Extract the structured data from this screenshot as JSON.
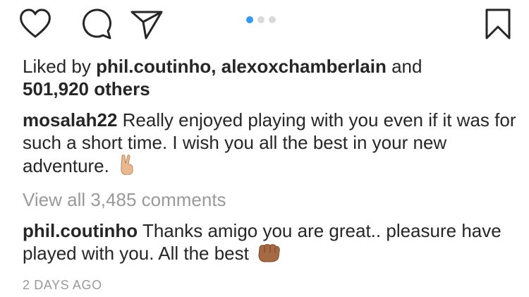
{
  "actions": {
    "like_icon": "heart-icon",
    "comment_icon": "comment-bubble-icon",
    "share_icon": "paper-plane-icon",
    "save_icon": "bookmark-icon"
  },
  "carousel": {
    "count": 3,
    "active_index": 0,
    "active_color": "#3897f0",
    "inactive_color": "#d9d9d9"
  },
  "likes": {
    "prefix": "Liked by",
    "user1": "phil.coutinho,",
    "user2": "alexoxchamberlain",
    "and": "and",
    "others_count": "501,920 others"
  },
  "caption": {
    "username": "mosalah22",
    "text": "Really enjoyed playing with you even if it was for such a short time. I wish you all the best in your new adventure.",
    "emoji": "victory-hand-emoji"
  },
  "view_all": "View all 3,485 comments",
  "reply": {
    "username": "phil.coutinho",
    "text": "Thanks amigo you are great.. pleasure have played with you. All the best",
    "emoji": "fist-bump-emoji"
  },
  "timestamp": "2 DAYS AGO",
  "colors": {
    "text": "#262626",
    "muted": "#999999",
    "accent": "#3897f0"
  }
}
